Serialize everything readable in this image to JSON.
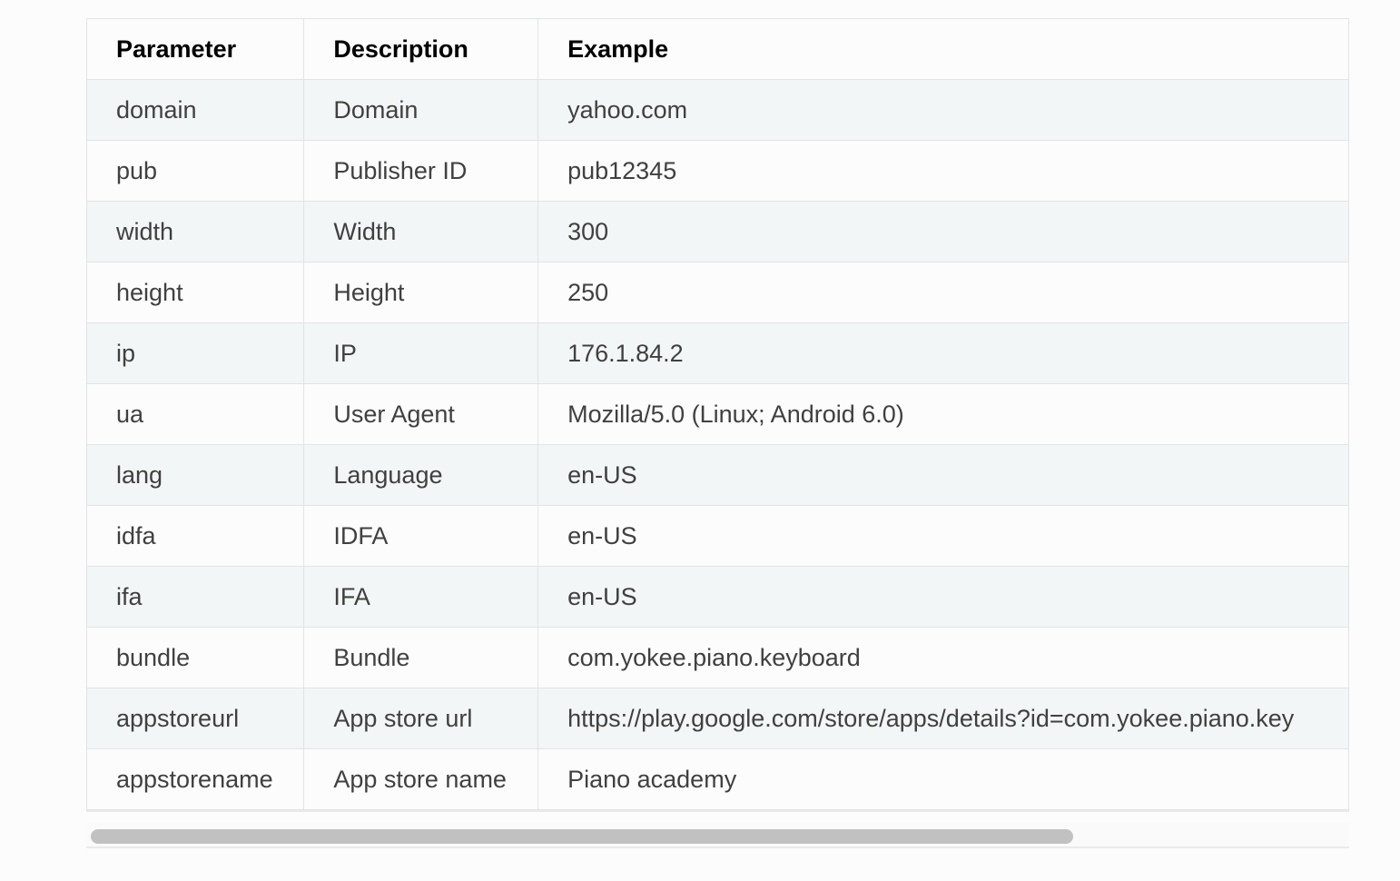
{
  "table": {
    "headers": [
      "Parameter",
      "Description",
      "Example"
    ],
    "rows": [
      [
        "domain",
        "Domain",
        "yahoo.com"
      ],
      [
        "pub",
        "Publisher ID",
        "pub12345"
      ],
      [
        "width",
        "Width",
        "300"
      ],
      [
        "height",
        "Height",
        "250"
      ],
      [
        "ip",
        "IP",
        "176.1.84.2"
      ],
      [
        "ua",
        "User Agent",
        "Mozilla/5.0 (Linux; Android 6.0)"
      ],
      [
        "lang",
        "Language",
        "en-US"
      ],
      [
        "idfa",
        "IDFA",
        "en-US"
      ],
      [
        "ifa",
        "IFA",
        "en-US"
      ],
      [
        "bundle",
        "Bundle",
        "com.yokee.piano.keyboard"
      ],
      [
        "appstoreurl",
        "App store url",
        "https://play.google.com/store/apps/details?id=com.yokee.piano.key"
      ],
      [
        "appstorename",
        "App store name",
        "Piano academy"
      ]
    ]
  },
  "colors": {
    "stripe": "#f3f6f6",
    "border": "#e1e4e5",
    "text": "#404040",
    "scrollbar_thumb": "#c1c1c1"
  }
}
